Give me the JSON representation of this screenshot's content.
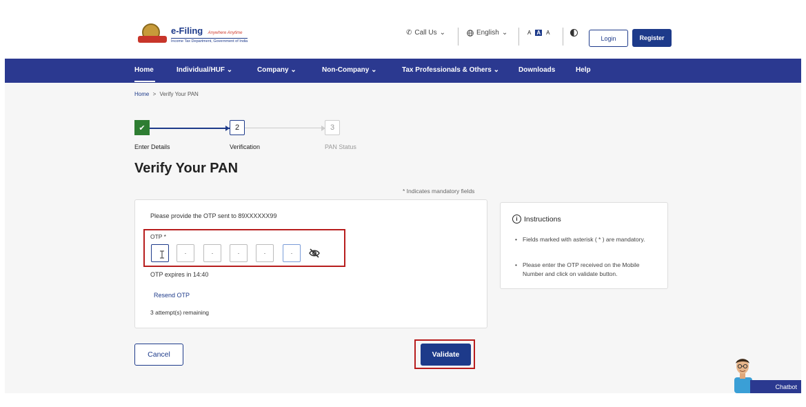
{
  "header": {
    "logo_title": "e-Filing",
    "logo_tagline": "Anywhere Anytime",
    "logo_subtitle": "Income Tax Department, Government of India",
    "call_us": "Call Us",
    "language": "English",
    "font_small": "A",
    "font_normal": "A",
    "font_large": "A",
    "login": "Login",
    "register": "Register"
  },
  "nav": {
    "items": [
      {
        "label": "Home"
      },
      {
        "label": "Individual/HUF"
      },
      {
        "label": "Company"
      },
      {
        "label": "Non-Company"
      },
      {
        "label": "Tax Professionals & Others"
      },
      {
        "label": "Downloads"
      },
      {
        "label": "Help"
      }
    ]
  },
  "breadcrumb": {
    "home": "Home",
    "separator": ">",
    "current": "Verify Your PAN"
  },
  "stepper": {
    "steps": [
      {
        "number": "✔",
        "label": "Enter Details",
        "state": "done"
      },
      {
        "number": "2",
        "label": "Verification",
        "state": "active"
      },
      {
        "number": "3",
        "label": "PAN Status",
        "state": "pending"
      }
    ]
  },
  "page": {
    "title": "Verify Your PAN",
    "mandatory_note": "* Indicates mandatory fields"
  },
  "otp": {
    "message": "Please provide the OTP sent to 89XXXXXX99",
    "label": "OTP *",
    "boxes": [
      "",
      "·",
      "·",
      "·",
      "·",
      "·"
    ],
    "expires": "OTP expires in 14:40",
    "resend": "Resend OTP",
    "attempts": "3 attempt(s) remaining"
  },
  "instructions": {
    "title": "Instructions",
    "items": [
      "Fields marked with asterisk ( * ) are mandatory.",
      "Please enter the OTP received on the Mobile Number and click on validate button."
    ]
  },
  "actions": {
    "cancel": "Cancel",
    "validate": "Validate"
  },
  "chatbot": {
    "label": "Chatbot"
  },
  "colors": {
    "primary": "#2b3990",
    "accent_red": "#b71c1c",
    "success": "#2e7d32"
  }
}
